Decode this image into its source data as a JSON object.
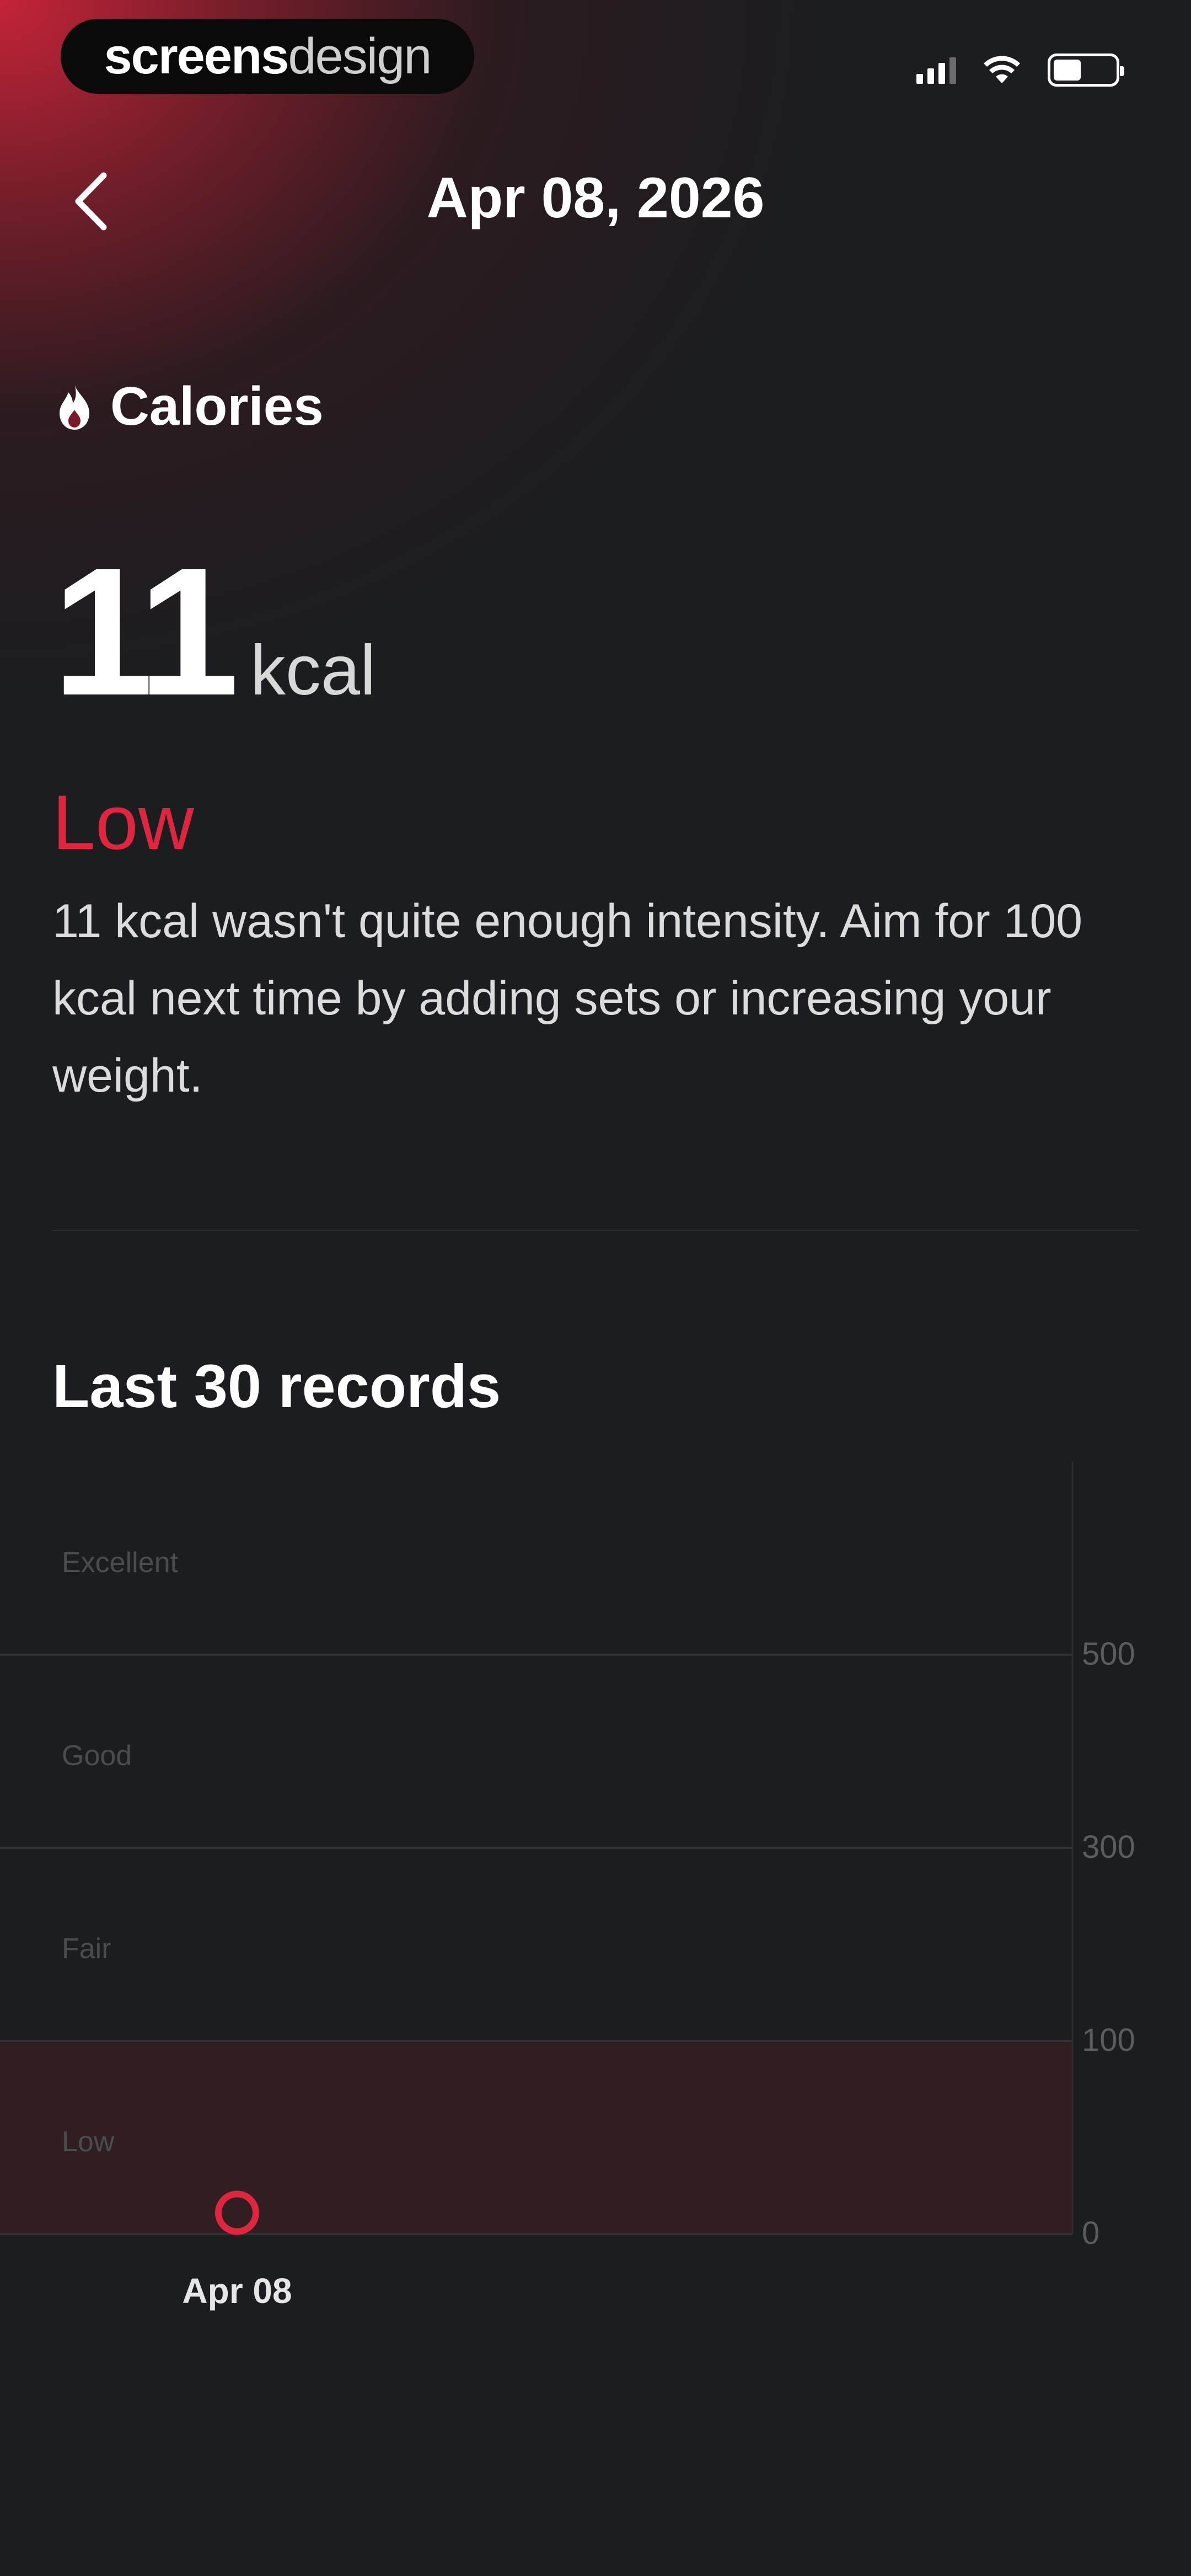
{
  "status_bar": {
    "watermark_bold": "screens",
    "watermark_light": "design"
  },
  "header": {
    "title": "Apr 08, 2026"
  },
  "metric": {
    "label": "Calories",
    "value": "11",
    "unit": "kcal",
    "level": "Low",
    "level_color": "#e0263f",
    "description": "11 kcal wasn't quite enough intensity. Aim for 100 kcal next time by adding sets or increasing your weight."
  },
  "history": {
    "title": "Last 30 records"
  },
  "chart_data": {
    "type": "scatter",
    "title": "Last 30 records",
    "zones": [
      {
        "name": "Excellent",
        "from": 500,
        "to": 700
      },
      {
        "name": "Good",
        "from": 300,
        "to": 500
      },
      {
        "name": "Fair",
        "from": 100,
        "to": 300
      },
      {
        "name": "Low",
        "from": 0,
        "to": 100,
        "highlighted": true
      }
    ],
    "y_ticks": [
      500,
      300,
      100,
      0
    ],
    "ylim": [
      0,
      700
    ],
    "x": [
      "Apr 08"
    ],
    "values": [
      11
    ],
    "grid": true,
    "accent_color": "#e0263f"
  }
}
